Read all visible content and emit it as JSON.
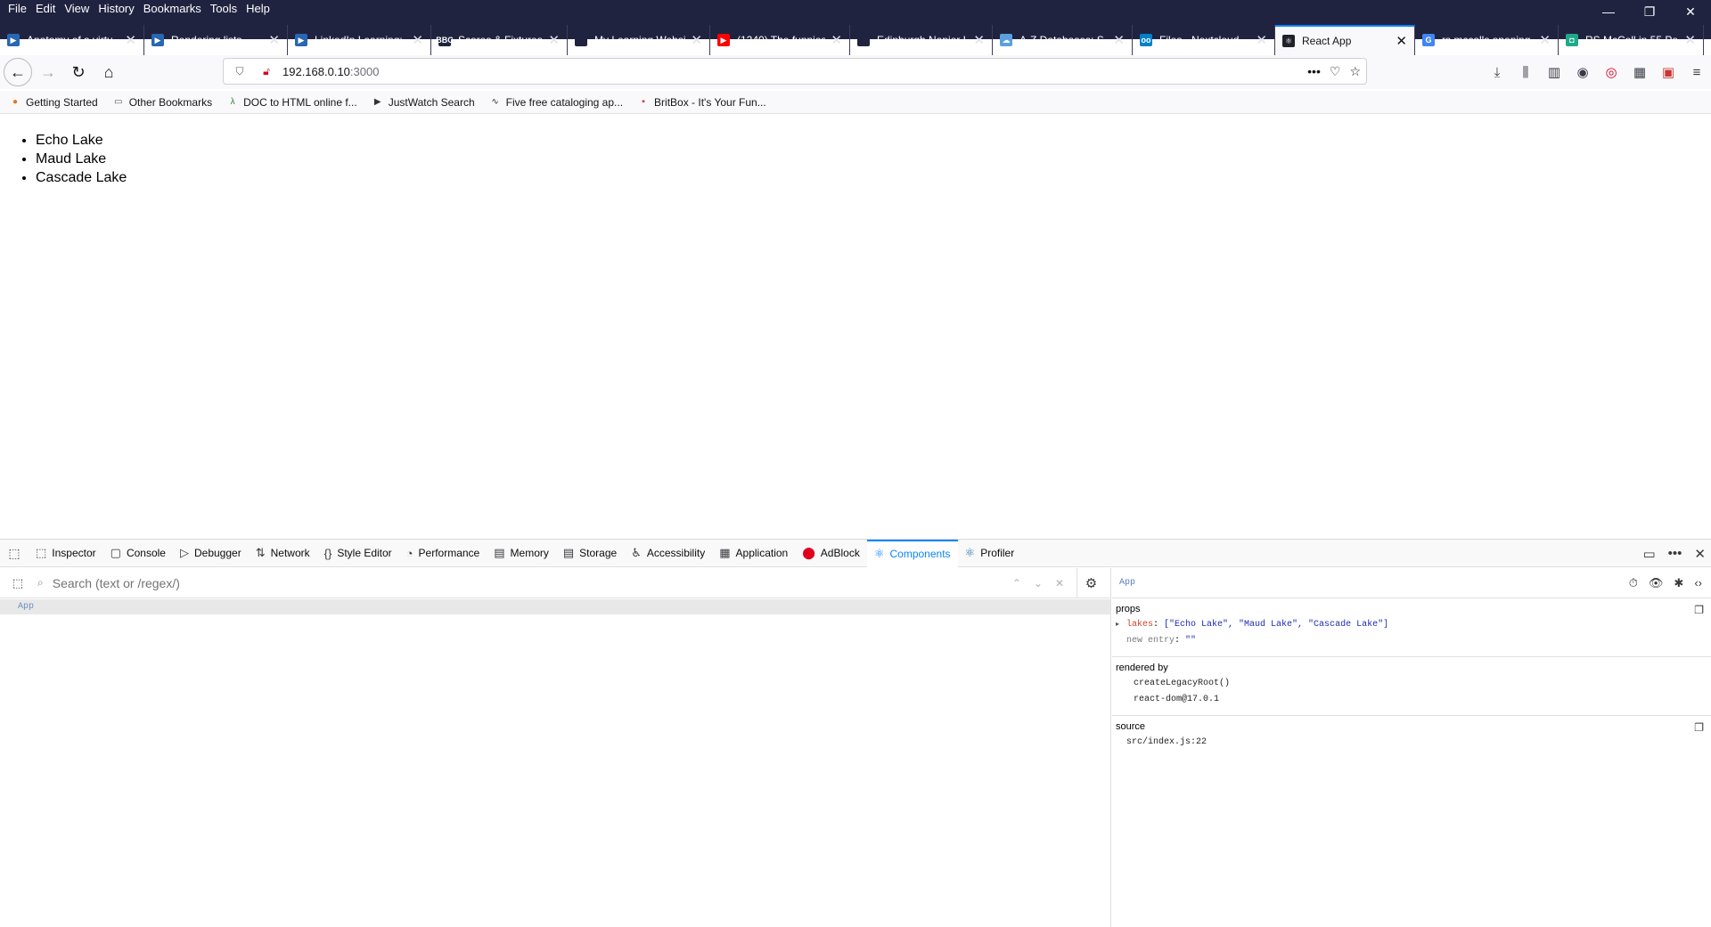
{
  "browser": {
    "menu": [
      "File",
      "Edit",
      "View",
      "History",
      "Bookmarks",
      "Tools",
      "Help"
    ],
    "window_controls": {
      "minimize": "—",
      "restore": "❐",
      "close": "✕"
    },
    "tabs": [
      {
        "label": "Anatomy of a virtu",
        "icon": "linkedin-learning-icon",
        "color": "#2867b2",
        "glyph": "▶"
      },
      {
        "label": "Rendering lists",
        "icon": "linkedin-learning-icon",
        "color": "#2867b2",
        "glyph": "▶"
      },
      {
        "label": "LinkedIn Learning:",
        "icon": "linkedin-learning-icon",
        "color": "#2867b2",
        "glyph": "▶"
      },
      {
        "label": "Scores & Fixtures",
        "icon": "bbc-icon",
        "color": "#202340",
        "glyph": "BBC"
      },
      {
        "label": "My Learning Website",
        "icon": "blank-page-icon",
        "color": "#202340",
        "glyph": ""
      },
      {
        "label": "(1240) The funnies",
        "icon": "youtube-icon",
        "color": "#ff0000",
        "glyph": "▶"
      },
      {
        "label": "Edinburgh Napier Univ",
        "icon": "blank-page-icon",
        "color": "#202340",
        "glyph": ""
      },
      {
        "label": "A-Z Databases: S",
        "icon": "cloud-icon",
        "color": "#5aa0e0",
        "glyph": "☁"
      },
      {
        "label": "Files - Nextcloud",
        "icon": "nextcloud-icon",
        "color": "#0082c9",
        "glyph": "oo"
      },
      {
        "label": "React App",
        "icon": "react-icon",
        "color": "#20232a",
        "glyph": "⚛",
        "active": true
      },
      {
        "label": "rs mccolls opening",
        "icon": "google-icon",
        "color": "#4285f4",
        "glyph": "G"
      },
      {
        "label": "RS McColl in 55 Pe",
        "icon": "site-icon",
        "color": "#1fa98a",
        "glyph": "◘"
      }
    ],
    "new_tab": "+",
    "url": {
      "host": "192.168.0.10",
      "port": ":3000"
    },
    "bookmarks": [
      {
        "label": "Getting Started",
        "icon": "firefox-icon",
        "glyph": "●",
        "color": "#e8741c"
      },
      {
        "label": "Other Bookmarks",
        "icon": "folder-icon",
        "glyph": "▭",
        "color": "#555"
      },
      {
        "label": "DOC to HTML online f...",
        "icon": "doc-converter-icon",
        "glyph": "λ",
        "color": "#2a8a2a"
      },
      {
        "label": "JustWatch Search",
        "icon": "justwatch-icon",
        "glyph": "▶",
        "color": "#333"
      },
      {
        "label": "Five free cataloging ap...",
        "icon": "wave-icon",
        "glyph": "∿",
        "color": "#333"
      },
      {
        "label": "BritBox - It's Your Fun...",
        "icon": "britbox-icon",
        "glyph": "▪",
        "color": "#c33"
      }
    ]
  },
  "page": {
    "lakes": [
      "Echo Lake",
      "Maud Lake",
      "Cascade Lake"
    ]
  },
  "devtools": {
    "tabs": [
      {
        "label": "Inspector",
        "icon": "inspector-icon",
        "glyph": "⬚"
      },
      {
        "label": "Console",
        "icon": "console-icon",
        "glyph": "▢"
      },
      {
        "label": "Debugger",
        "icon": "debugger-icon",
        "glyph": "▷"
      },
      {
        "label": "Network",
        "icon": "network-icon",
        "glyph": "⇅"
      },
      {
        "label": "Style Editor",
        "icon": "style-editor-icon",
        "glyph": "{}"
      },
      {
        "label": "Performance",
        "icon": "performance-icon",
        "glyph": "◔"
      },
      {
        "label": "Memory",
        "icon": "memory-icon",
        "glyph": "▤"
      },
      {
        "label": "Storage",
        "icon": "storage-icon",
        "glyph": "▤"
      },
      {
        "label": "Accessibility",
        "icon": "accessibility-icon",
        "glyph": "♿"
      },
      {
        "label": "Application",
        "icon": "application-icon",
        "glyph": "▦"
      },
      {
        "label": "AdBlock",
        "icon": "adblock-icon",
        "glyph": "⬤"
      },
      {
        "label": "Components",
        "icon": "react-icon",
        "glyph": "⚛",
        "active": true
      },
      {
        "label": "Profiler",
        "icon": "react-icon",
        "glyph": "⚛"
      }
    ],
    "search_placeholder": "Search (text or /regex/)",
    "tree": [
      {
        "label": "App"
      }
    ],
    "selected": "App",
    "props": {
      "title": "props",
      "lakes_key": "lakes",
      "lakes_value": "[\"Echo Lake\", \"Maud Lake\", \"Cascade Lake\"]",
      "new_entry_key": "new entry",
      "new_entry_value": "\"\""
    },
    "rendered_by": {
      "title": "rendered by",
      "items": [
        "createLegacyRoot()",
        "react-dom@17.0.1"
      ]
    },
    "source": {
      "title": "source",
      "file": "src/index.js:22"
    }
  }
}
